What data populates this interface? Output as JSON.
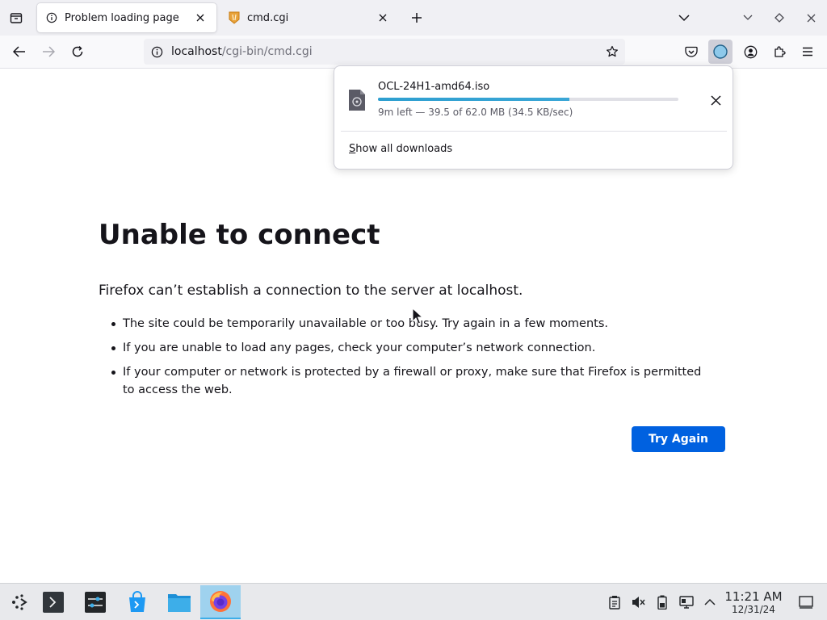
{
  "browser": {
    "tabs": [
      {
        "title": "Problem loading page",
        "active": true
      },
      {
        "title": "cmd.cgi",
        "active": false
      }
    ],
    "url": {
      "host": "localhost",
      "path": "/cgi-bin/cmd.cgi"
    }
  },
  "downloads": {
    "filename": "OCL-24H1-amd64.iso",
    "status": "9m left — 39.5 of 62.0 MB (34.5 KB/sec)",
    "progress_fraction": 0.637,
    "show_all_first": "S",
    "show_all_rest": "how all downloads"
  },
  "error_page": {
    "title": "Unable to connect",
    "short_desc": "Firefox can’t establish a connection to the server at localhost.",
    "bullets": [
      "The site could be temporarily unavailable or too busy. Try again in a few moments.",
      "If you are unable to load any pages, check your computer’s network connection.",
      "If your computer or network is protected by a firewall or proxy, make sure that Firefox is permitted to access the web."
    ],
    "try_again_label": "Try Again"
  },
  "taskbar": {
    "clock_time": "11:21 AM",
    "clock_date": "12/31/24"
  },
  "colors": {
    "accent": "#0061e0",
    "progress": "#3aa6d6",
    "taskbar_active": "#9fd2ee"
  }
}
